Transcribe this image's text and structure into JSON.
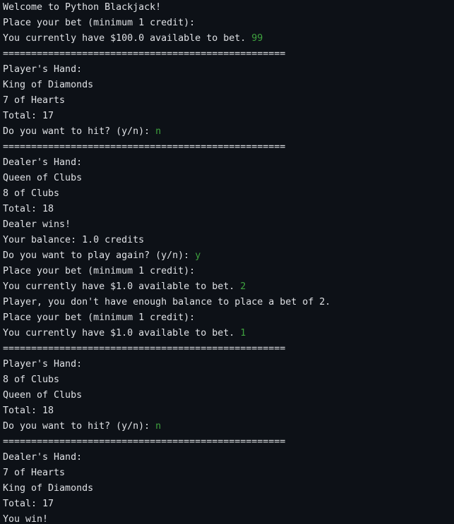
{
  "terminal": {
    "input_color": "#3fa33f",
    "text_color": "#dfe1e5",
    "background": "#0d1117",
    "lines": [
      {
        "text": "Welcome to Python Blackjack!",
        "input": ""
      },
      {
        "text": "Place your bet (minimum 1 credit):",
        "input": ""
      },
      {
        "text": "You currently have $100.0 available to bet. ",
        "input": "99"
      },
      {
        "text": "==================================================",
        "input": ""
      },
      {
        "text": "Player's Hand:",
        "input": ""
      },
      {
        "text": "King of Diamonds",
        "input": ""
      },
      {
        "text": "7 of Hearts",
        "input": ""
      },
      {
        "text": "Total: 17",
        "input": ""
      },
      {
        "text": "Do you want to hit? (y/n): ",
        "input": "n"
      },
      {
        "text": "==================================================",
        "input": ""
      },
      {
        "text": "Dealer's Hand:",
        "input": ""
      },
      {
        "text": "Queen of Clubs",
        "input": ""
      },
      {
        "text": "8 of Clubs",
        "input": ""
      },
      {
        "text": "Total: 18",
        "input": ""
      },
      {
        "text": "Dealer wins!",
        "input": ""
      },
      {
        "text": "Your balance: 1.0 credits",
        "input": ""
      },
      {
        "text": "Do you want to play again? (y/n): ",
        "input": "y"
      },
      {
        "text": "Place your bet (minimum 1 credit):",
        "input": ""
      },
      {
        "text": "You currently have $1.0 available to bet. ",
        "input": "2"
      },
      {
        "text": "Player, you don't have enough balance to place a bet of 2.",
        "input": ""
      },
      {
        "text": "Place your bet (minimum 1 credit):",
        "input": ""
      },
      {
        "text": "You currently have $1.0 available to bet. ",
        "input": "1"
      },
      {
        "text": "==================================================",
        "input": ""
      },
      {
        "text": "Player's Hand:",
        "input": ""
      },
      {
        "text": "8 of Clubs",
        "input": ""
      },
      {
        "text": "Queen of Clubs",
        "input": ""
      },
      {
        "text": "Total: 18",
        "input": ""
      },
      {
        "text": "Do you want to hit? (y/n): ",
        "input": "n"
      },
      {
        "text": "==================================================",
        "input": ""
      },
      {
        "text": "Dealer's Hand:",
        "input": ""
      },
      {
        "text": "7 of Hearts",
        "input": ""
      },
      {
        "text": "King of Diamonds",
        "input": ""
      },
      {
        "text": "Total: 17",
        "input": ""
      },
      {
        "text": "You win!",
        "input": ""
      }
    ]
  }
}
